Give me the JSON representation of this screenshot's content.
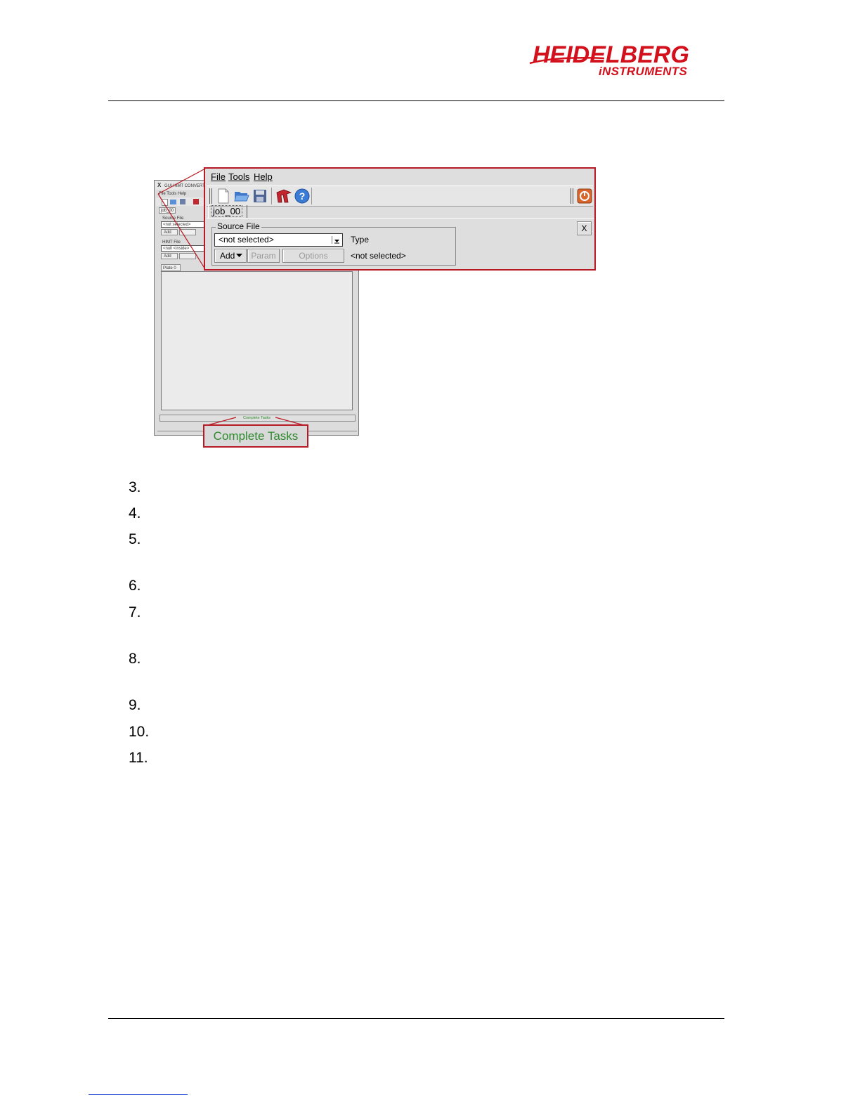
{
  "header": {
    "logo_main": "HEIDELBERG",
    "logo_sub": "iNSTRUMENTS",
    "brand_color": "#d2111d"
  },
  "small_window": {
    "title": "GUI HIMT CONVERT",
    "menu": "File Tools Help",
    "tab": "job_00",
    "source_label": "Source File",
    "source_value": "<not selected>",
    "add_label": "Add",
    "himt_label": "HIMT File",
    "himt_value": "<null <inside>",
    "add2_label": "Add",
    "plate_tab": "Plate 0",
    "status": "Complete Tasks"
  },
  "zoom_panel": {
    "menu": {
      "file": "File",
      "tools": "Tools",
      "help": "Help"
    },
    "toolbar_icons": [
      "new-file-icon",
      "open-folder-icon",
      "save-disk-icon",
      "converter-tool-icon",
      "help-icon",
      "power-icon"
    ],
    "tab": "job_00",
    "close_label": "X",
    "source_legend": "Source File",
    "combo_value": "<not selected>",
    "type_label": "Type",
    "type_value": "<not selected>",
    "add_button": "Add",
    "param_button": "Param",
    "options_button": "Options"
  },
  "callout": {
    "text": "Complete Tasks",
    "color": "#2e8b2e",
    "border_color": "#b71a24"
  },
  "step_numbers": [
    "3.",
    "4.",
    "5.",
    "6.",
    "7.",
    "8.",
    "9.",
    "10.",
    "11."
  ]
}
